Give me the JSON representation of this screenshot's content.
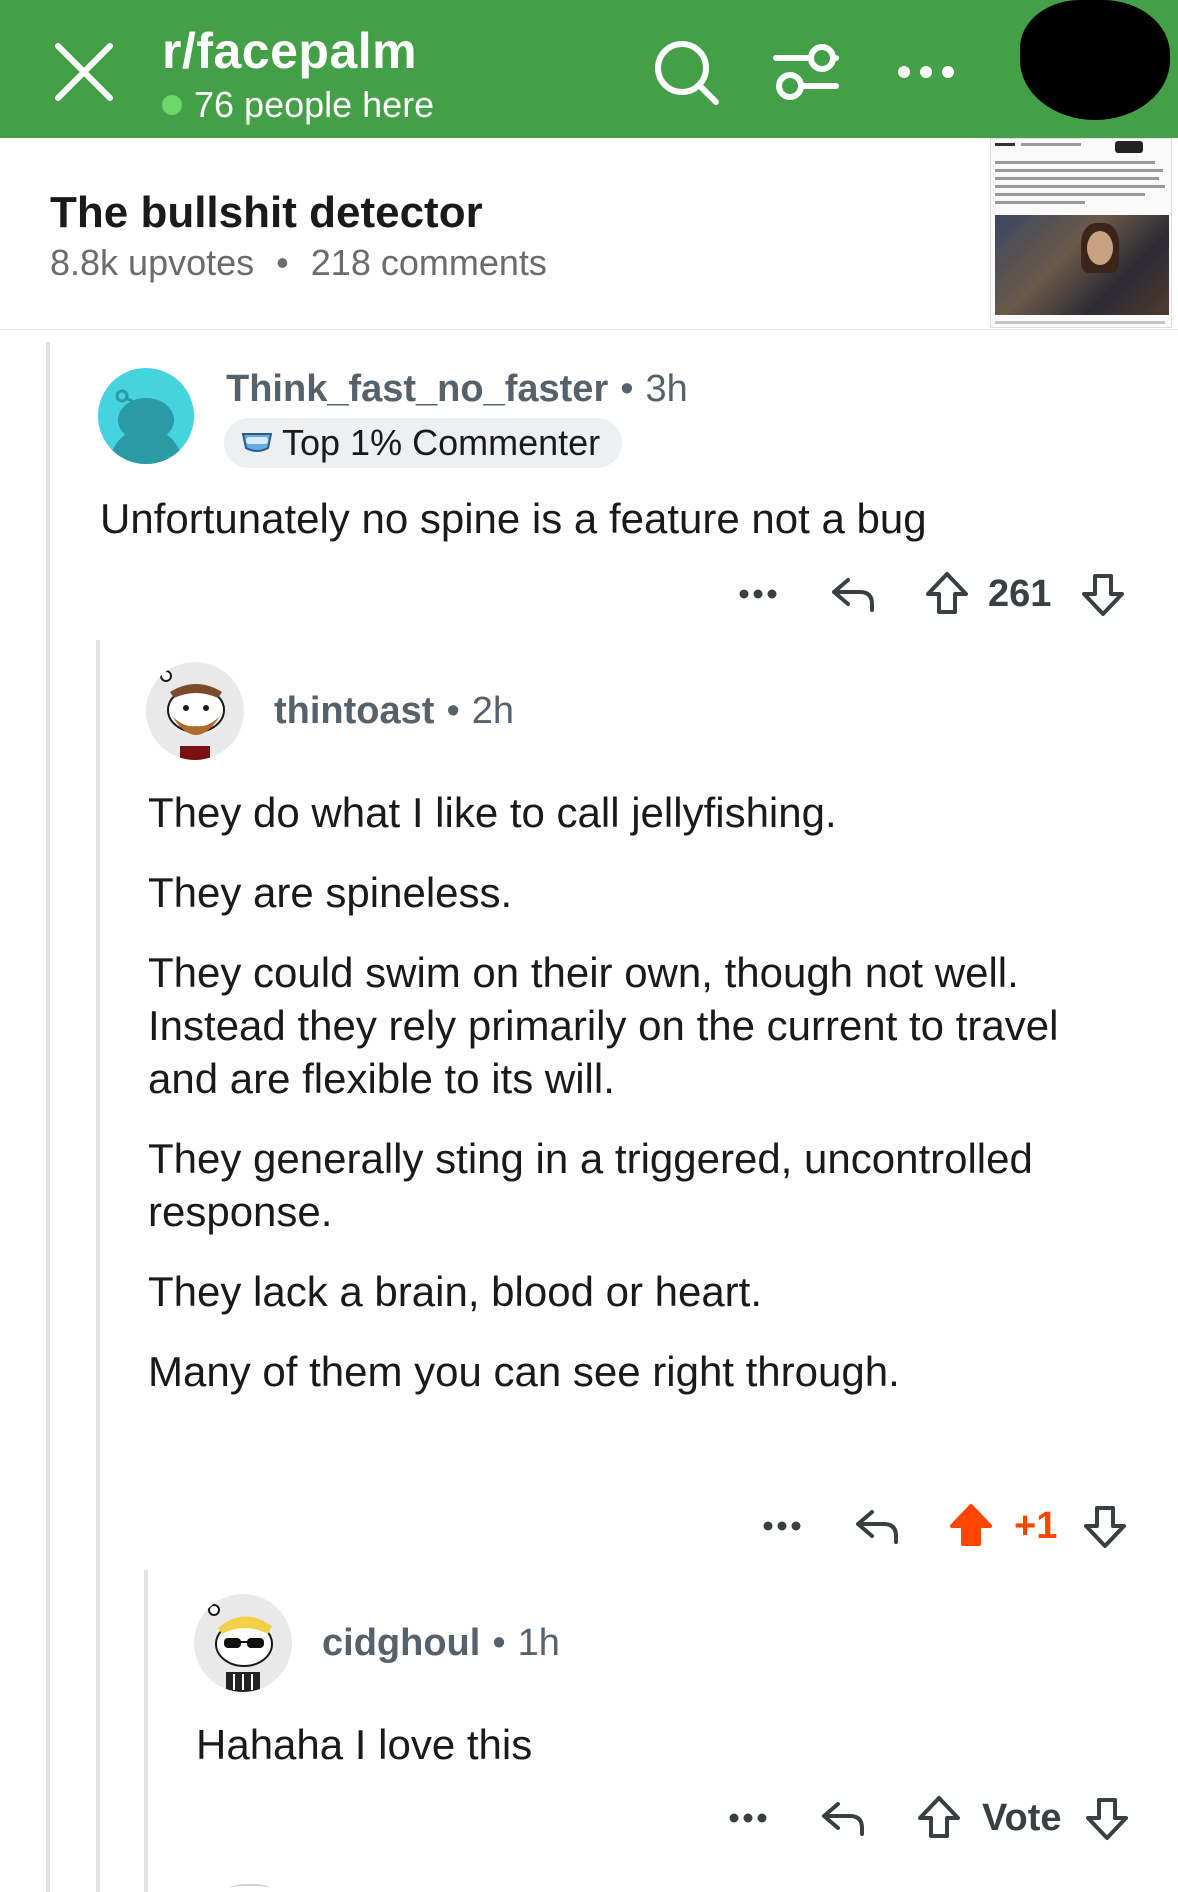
{
  "header": {
    "subreddit": "r/facepalm",
    "online_text": "76 people here",
    "close_icon": "close-icon",
    "search_icon": "search-icon",
    "filter_icon": "filter-icon",
    "more_icon": "more-icon",
    "accent_color": "#44a047"
  },
  "post": {
    "title": "The bullshit detector",
    "upvotes": "8.8k upvotes",
    "separator": "•",
    "comments": "218 comments"
  },
  "comments": [
    {
      "username": "Think_fast_no_faster",
      "separator": "•",
      "time": "3h",
      "flair": "Top 1% Commenter",
      "paragraphs": [
        "Unfortunately no spine is a feature not a bug"
      ],
      "votes": "261",
      "upvoted": false
    },
    {
      "username": "thintoast",
      "separator": "•",
      "time": "2h",
      "paragraphs": [
        "They do what I like to call jellyfishing.",
        "They are spineless.",
        "They could swim on their own, though not well. Instead they rely primarily on the current to travel and are flexible to its will.",
        "They generally sting in a triggered, uncontrolled response.",
        "They lack a brain, blood or heart.",
        "Many of them you can see right through."
      ],
      "votes": "+1",
      "upvoted": true,
      "upvote_color": "#ff4500"
    },
    {
      "username": "cidghoul",
      "separator": "•",
      "time": "1h",
      "paragraphs": [
        "Hahaha I love this"
      ],
      "votes": "Vote",
      "upvoted": false
    }
  ]
}
